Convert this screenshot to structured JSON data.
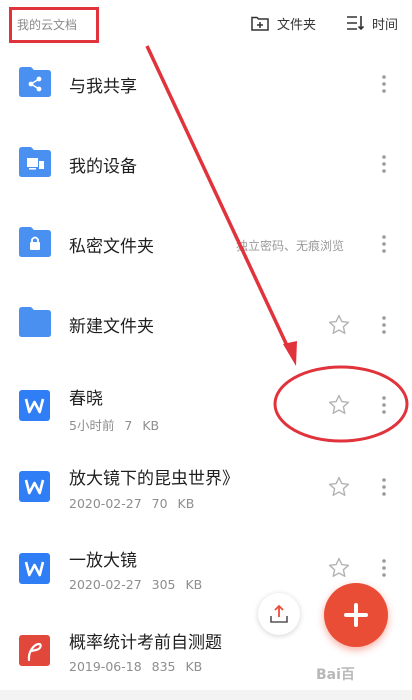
{
  "header": {
    "breadcrumb": "我的云文档",
    "new_folder_label": "文件夹",
    "sort_label": "时间"
  },
  "files": [
    {
      "name": "与我共享",
      "meta": "",
      "hint": "",
      "icon": "shared-folder-icon",
      "starrable": false
    },
    {
      "name": "我的设备",
      "meta": "",
      "hint": "",
      "icon": "device-folder-icon",
      "starrable": false
    },
    {
      "name": "私密文件夹",
      "meta": "",
      "hint": "独立密码、无痕浏览",
      "icon": "locked-folder-icon",
      "starrable": false
    },
    {
      "name": "新建文件夹",
      "meta": "",
      "hint": "",
      "icon": "folder-icon",
      "starrable": true
    },
    {
      "name": "春晓",
      "meta": "5小时前 7 KB",
      "hint": "",
      "icon": "word-doc-icon",
      "starrable": true
    },
    {
      "name": "放大镜下的昆虫世界》",
      "meta": "2020-02-27 70 KB",
      "hint": "",
      "icon": "word-doc-icon",
      "starrable": true
    },
    {
      "name": "一放大镜",
      "meta": "2020-02-27 305 KB",
      "hint": "",
      "icon": "word-doc-icon",
      "starrable": true
    },
    {
      "name": "概率统计考前自测题",
      "meta": "2019-06-18 835 KB",
      "hint": "",
      "icon": "pdf-doc-icon",
      "starrable": true
    }
  ],
  "watermark": "Bai百",
  "colors": {
    "accent": "#ea4d36",
    "folder_blue": "#4a90f0",
    "word_blue": "#2f7ef5",
    "pdf_red": "#e2473b",
    "annotation_red": "#e0333c"
  }
}
